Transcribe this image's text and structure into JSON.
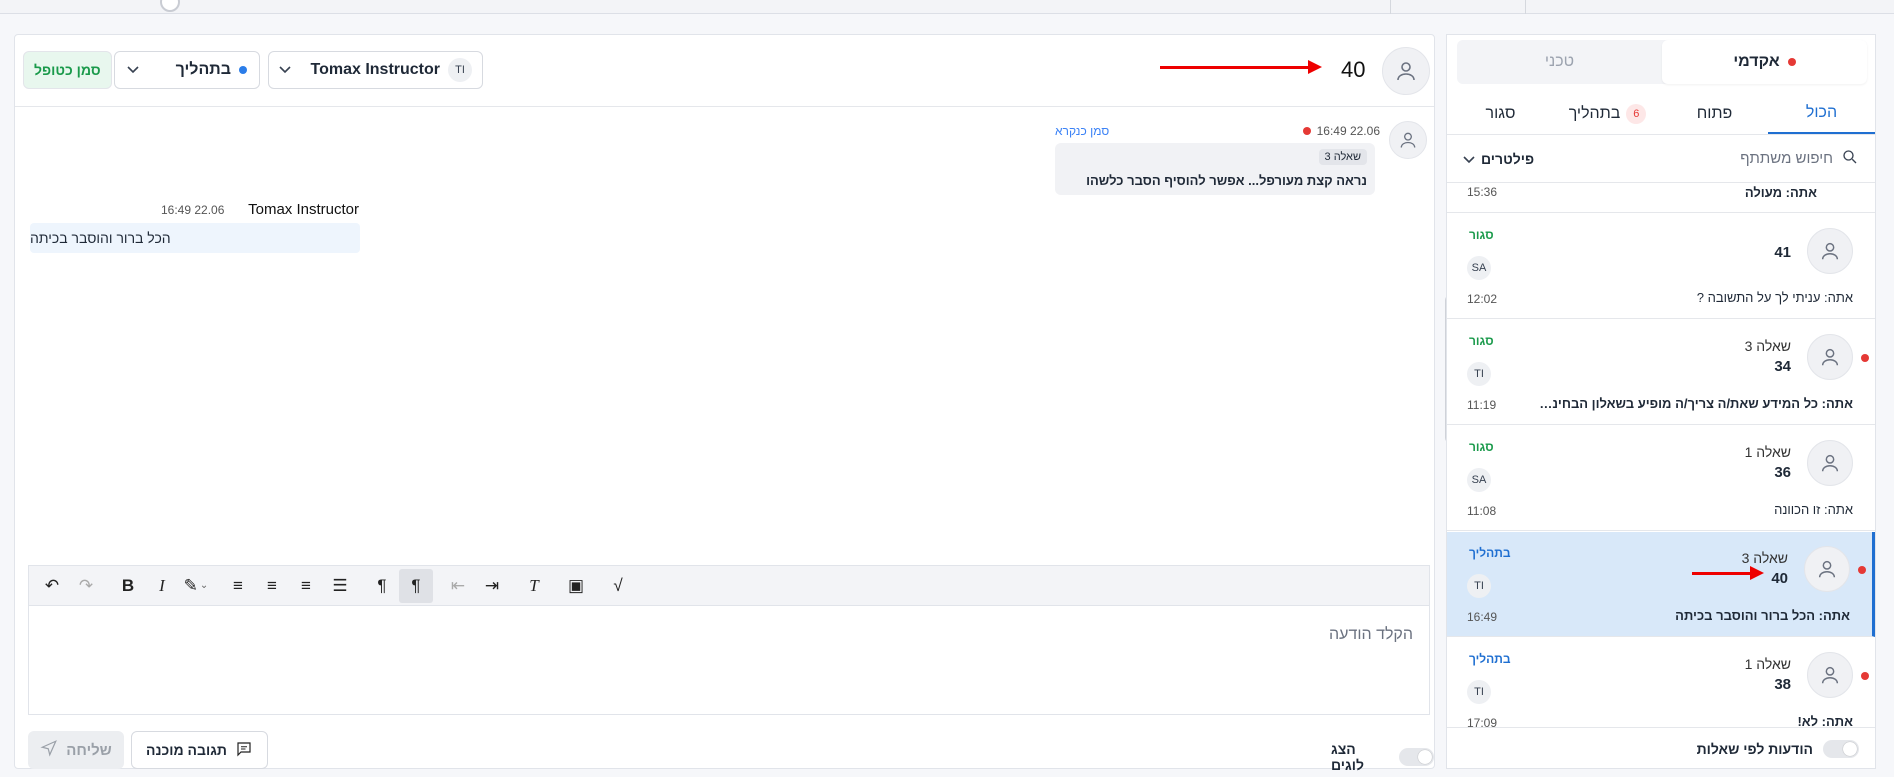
{
  "header": {
    "mark_read": "סמן כטופל",
    "status": "בתהליך",
    "assignee_initials": "TI",
    "assignee_name": "Tomax Instructor",
    "thread_number": "40"
  },
  "messages": [
    {
      "author": "סמן כנקרא",
      "time": "16:49 22.06",
      "question": "שאלה 3",
      "text": "נראה קצת מעורפל... אפשר להוסיף הסבר כלשהו"
    },
    {
      "author": "Tomax Instructor",
      "time": "16:49 22.06",
      "text": "הכל ברור והוסבר בכיתה"
    }
  ],
  "editor": {
    "placeholder": "הקלד הודעה",
    "send": "שליחה",
    "canned": "תגובה מוכנה",
    "logs": "הצג לוגים"
  },
  "sidebar": {
    "segments": {
      "academic": "אקדמי",
      "technical": "טכני"
    },
    "tabs": [
      {
        "label": "הכול"
      },
      {
        "label": "פתוח"
      },
      {
        "label": "בתהליך",
        "badge": "6"
      },
      {
        "label": "סגור"
      }
    ],
    "search_placeholder": "חיפוש משתתף",
    "filters": "פילטרים",
    "partial_item": {
      "preview": "אתה: מעולה",
      "time": "15:36"
    },
    "items": [
      {
        "question": "",
        "number": "41",
        "status": "סגור",
        "initials": "SA",
        "time": "12:02",
        "preview": "אתה: עניתי לך על התשובה ?"
      },
      {
        "question": "שאלה 3",
        "number": "34",
        "status": "סגור",
        "initials": "TI",
        "time": "11:19",
        "preview": "אתה: כל המידע שאת/ה צריך/ה מופיע בשאלון הבחינה. ב..."
      },
      {
        "question": "שאלה 1",
        "number": "36",
        "status": "סגור",
        "initials": "SA",
        "time": "11:08",
        "preview": "אתה: זו הכוונה"
      },
      {
        "question": "שאלה 3",
        "number": "40",
        "status": "בתהליך",
        "initials": "TI",
        "time": "16:49",
        "preview": "אתה: הכל ברור והוסבר בכיתה"
      },
      {
        "question": "שאלה 1",
        "number": "38",
        "status": "בתהליך",
        "initials": "TI",
        "time": "17:09",
        "preview": "אתה: לא!"
      }
    ],
    "footer_toggle": "הודעות לפי שאלות"
  }
}
